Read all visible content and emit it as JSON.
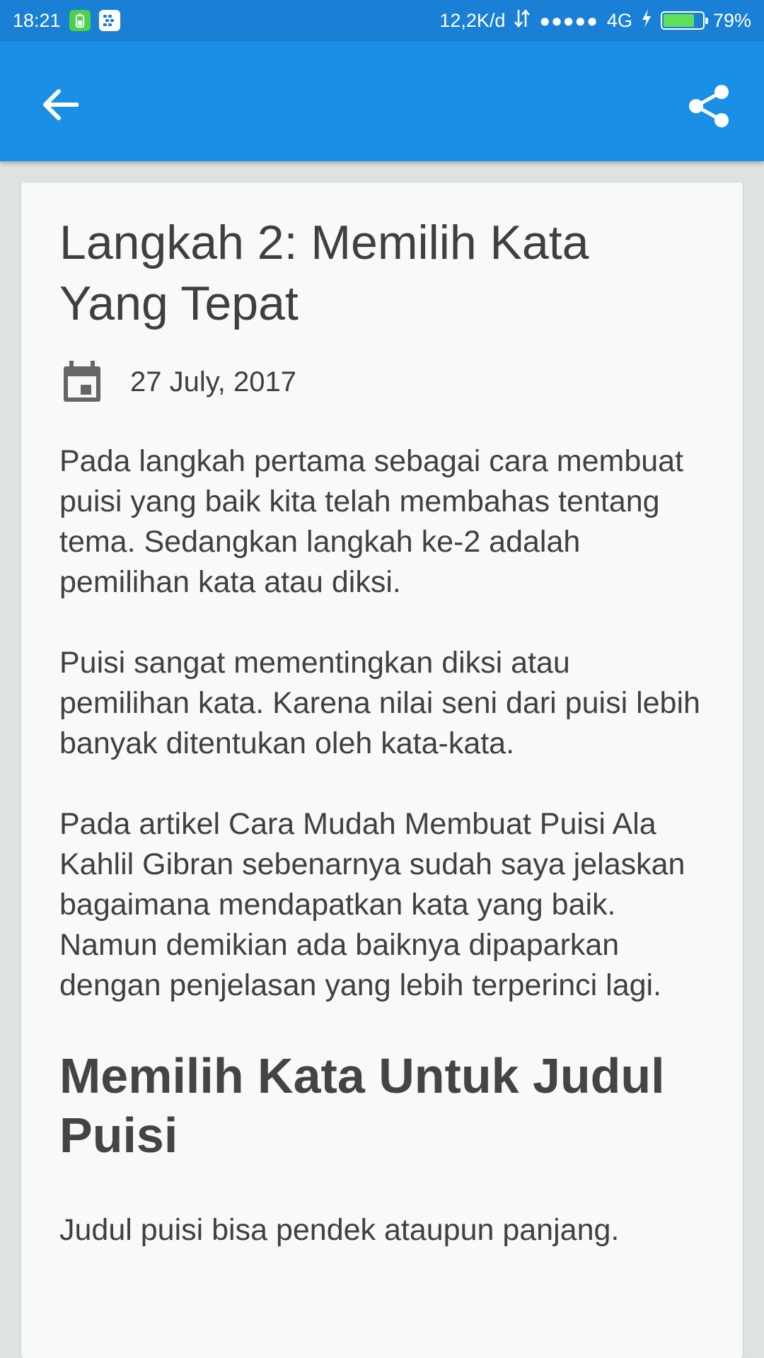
{
  "status_bar": {
    "time": "18:21",
    "network_speed": "12,2K/d",
    "signal_dots": "●●●●●",
    "network_type": "4G",
    "battery_percent": "79%",
    "battery_level": 0.79
  },
  "app_bar": {
    "back_icon": "arrow-back-icon",
    "share_icon": "share-icon"
  },
  "article": {
    "title": "Langkah 2: Memilih Kata Yang Tepat",
    "date": "27 July, 2017",
    "paragraphs": [
      "Pada langkah pertama sebagai cara membuat puisi yang baik kita telah membahas tentang tema. Sedangkan langkah ke-2 adalah pemilihan kata atau diksi.",
      "Puisi sangat mementingkan diksi atau pemilihan kata. Karena nilai seni dari puisi lebih banyak ditentukan oleh kata-kata.",
      "Pada artikel Cara Mudah Membuat Puisi Ala Kahlil Gibran sebenarnya sudah saya jelaskan bagaimana mendapatkan kata yang baik. Namun demikian ada baiknya dipaparkan dengan penjelasan yang lebih terperinci lagi."
    ],
    "section_heading": "Memilih Kata Untuk Judul Puisi",
    "section_paragraph": "Judul puisi bisa pendek ataupun panjang."
  },
  "colors": {
    "status_bar": "#1a80d6",
    "app_bar": "#1a8fe6",
    "card_background": "#f7faf7",
    "page_background": "#dfe3e0",
    "text": "#404040"
  }
}
